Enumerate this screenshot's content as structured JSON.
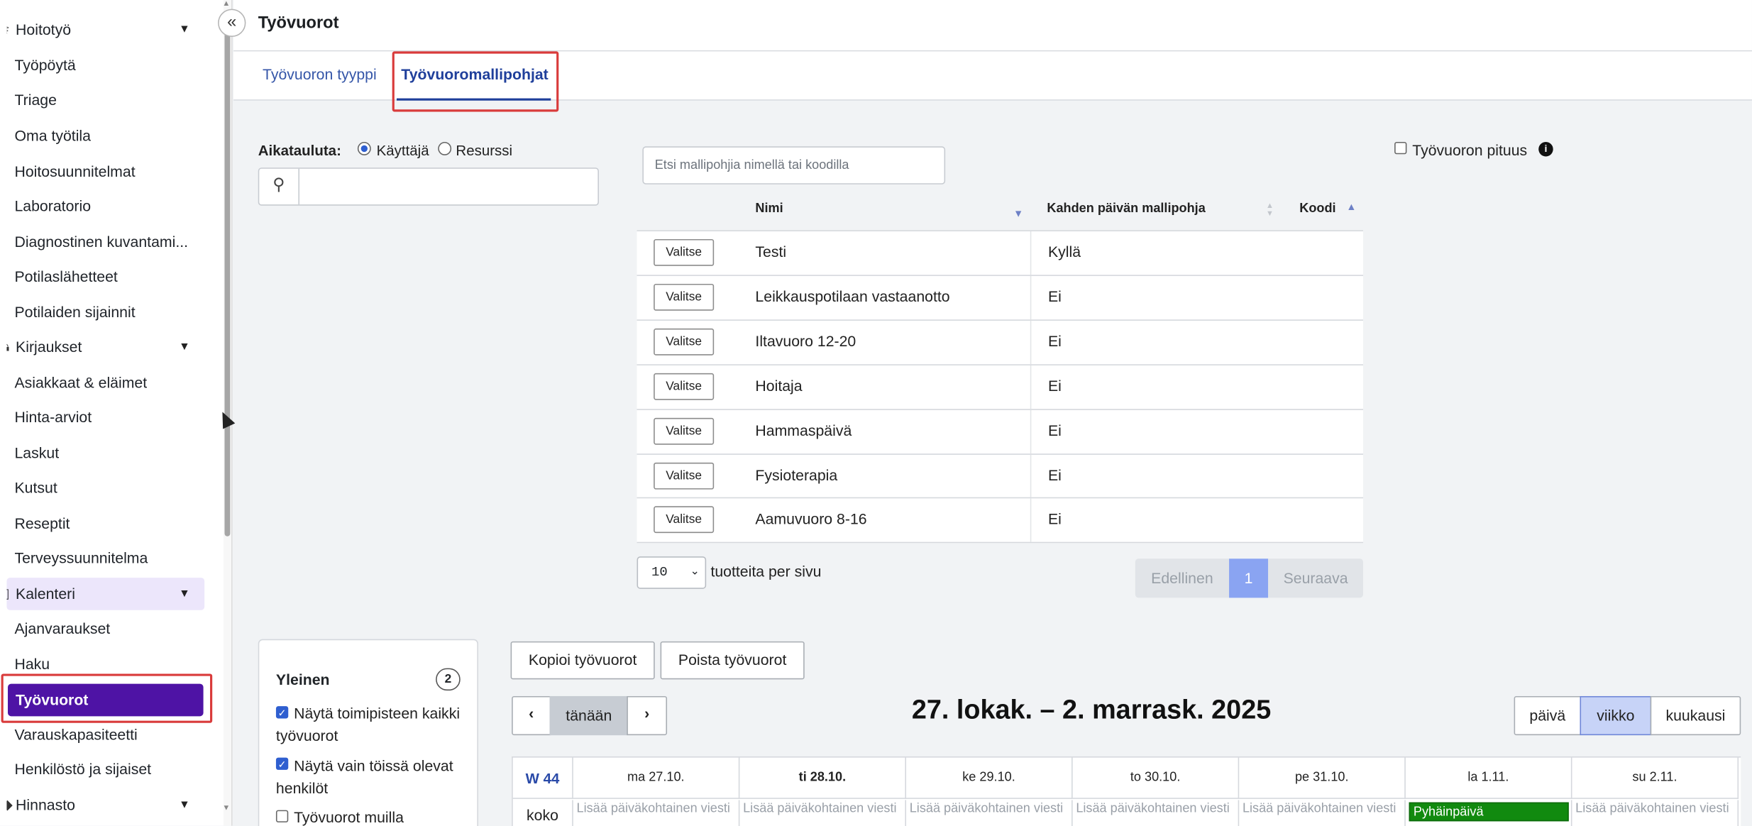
{
  "sidebar": {
    "items": [
      {
        "label": "Hoitotyö",
        "group": true
      },
      {
        "label": "Työpöytä"
      },
      {
        "label": "Triage"
      },
      {
        "label": "Oma työtila"
      },
      {
        "label": "Hoitosuunnitelmat"
      },
      {
        "label": "Laboratorio"
      },
      {
        "label": "Diagnostinen kuvantami..."
      },
      {
        "label": "Potilaslähetteet"
      },
      {
        "label": "Potilaiden sijainnit"
      },
      {
        "label": "Kirjaukset",
        "group": true
      },
      {
        "label": "Asiakkaat & eläimet"
      },
      {
        "label": "Hinta-arviot"
      },
      {
        "label": "Laskut"
      },
      {
        "label": "Kutsut"
      },
      {
        "label": "Reseptit"
      },
      {
        "label": "Terveyssuunnitelma"
      },
      {
        "label": "Kalenteri",
        "group": true
      },
      {
        "label": "Ajanvaraukset"
      },
      {
        "label": "Haku"
      },
      {
        "label": "Työvuorot",
        "active": true
      },
      {
        "label": "Varauskapasiteetti"
      },
      {
        "label": "Henkilöstö ja sijaiset"
      },
      {
        "label": "Hinnasto",
        "group": true
      }
    ]
  },
  "header": {
    "title": "Työvuorot"
  },
  "tabs": [
    {
      "label": "Työvuoron tyyppi"
    },
    {
      "label": "Työvuoromallipohjat",
      "active": true
    }
  ],
  "schedule_filter": {
    "label": "Aikatauluta:",
    "option_user": "Käyttäjä",
    "option_resource": "Resurssi",
    "selected": "Käyttäjä"
  },
  "template_search": {
    "placeholder": "Etsi mallipohjia nimellä tai koodilla"
  },
  "shift_length": {
    "label": "Työvuoron pituus",
    "checked": false
  },
  "table": {
    "headers": {
      "name": "Nimi",
      "two_day": "Kahden päivän mallipohja",
      "code": "Koodi"
    },
    "select_label": "Valitse",
    "rows": [
      {
        "name": "Testi",
        "two_day": "Kyllä",
        "code": ""
      },
      {
        "name": "Leikkauspotilaan vastaanotto",
        "two_day": "Ei",
        "code": ""
      },
      {
        "name": "Iltavuoro 12-20",
        "two_day": "Ei",
        "code": ""
      },
      {
        "name": "Hoitaja",
        "two_day": "Ei",
        "code": ""
      },
      {
        "name": "Hammaspäivä",
        "two_day": "Ei",
        "code": ""
      },
      {
        "name": "Fysioterapia",
        "two_day": "Ei",
        "code": ""
      },
      {
        "name": "Aamuvuoro 8-16",
        "two_day": "Ei",
        "code": ""
      }
    ]
  },
  "pagination": {
    "per_page": "10",
    "per_page_label": "tuotteita per sivu",
    "prev": "Edellinen",
    "current": "1",
    "next": "Seuraava"
  },
  "general_panel": {
    "title": "Yleinen",
    "count": "2",
    "options": [
      {
        "label": "Näytä toimipisteen kaikki työvuorot",
        "checked": true
      },
      {
        "label": "Näytä vain töissä olevat henkilöt",
        "checked": true
      },
      {
        "label": "Työvuorot muilla",
        "checked": false
      }
    ]
  },
  "calendar": {
    "copy_label": "Kopioi työvuorot",
    "delete_label": "Poista työvuorot",
    "today_label": "tänään",
    "range": "27. lokak. – 2. marrask. 2025",
    "views": [
      "päivä",
      "viikko",
      "kuukausi"
    ],
    "active_view": "viikko",
    "week_label": "W 44",
    "days": [
      "ma 27.10.",
      "ti 28.10.",
      "ke 29.10.",
      "to 30.10.",
      "pe 31.10.",
      "la 1.11.",
      "su 2.11."
    ],
    "row_label": "koko",
    "placeholder_msg": "Lisää päiväkohtainen viesti",
    "holiday_label": "Pyhäinpäivä"
  },
  "colors": {
    "active_nav": "#4e13a5",
    "highlight": "#d93b3b",
    "tab_accent": "#1f3f9b",
    "holiday": "#118a0f",
    "active_view": "#c7d3f7"
  }
}
